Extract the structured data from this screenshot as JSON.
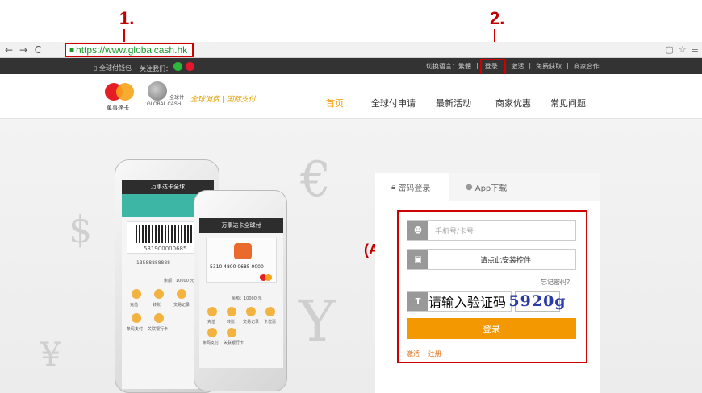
{
  "annotations": {
    "one": "1.",
    "two": "2.",
    "a": "(A)"
  },
  "browser": {
    "url": "https://www.globalcash.hk",
    "back": "←",
    "forward": "→",
    "reload": "C"
  },
  "topbar": {
    "client": "全球付钱包",
    "follow": "关注我们：",
    "language": "切换语言：繁體",
    "login": "登录",
    "activate": "激活",
    "free_get": "免费获取",
    "merchant": "商家合作",
    "sep": "|"
  },
  "header": {
    "mc_cn": "萬事達卡",
    "mc_brand": "MasterCard",
    "gc_cn": "全球付",
    "gc_en": "GLOBAL CASH",
    "slogan": "全球消费 | 国际支付",
    "nav": [
      "首页",
      "全球付申请",
      "最新活动",
      "商家优惠",
      "常见问题"
    ]
  },
  "phones": {
    "p1_title": "万事达卡全球",
    "p1_card": "531900000685",
    "p1_phone": "13588888888",
    "p1_balance": "余额：10000 元",
    "p2_title": "万事达卡全球付",
    "p2_card": "5310 4800 0685 0000",
    "p2_balance": "余额：10000 元",
    "icons": [
      "充值",
      "转账",
      "交易记录",
      "卡优惠",
      "条码支付",
      "关联银行卡"
    ]
  },
  "login_panel": {
    "tab_password": "密码登录",
    "tab_app": "App下载",
    "phone_placeholder": "手机号/卡号",
    "control_text": "请点此安装控件",
    "forgot": "忘记密码？",
    "captcha_placeholder": "请输入验证码",
    "captcha_value": "5920g",
    "captcha_prefix": "T",
    "login_button": "登录",
    "activate": "激活",
    "register": "注册",
    "sep": "|"
  },
  "colors": {
    "accent": "#f39800",
    "annotation": "#d00000"
  }
}
